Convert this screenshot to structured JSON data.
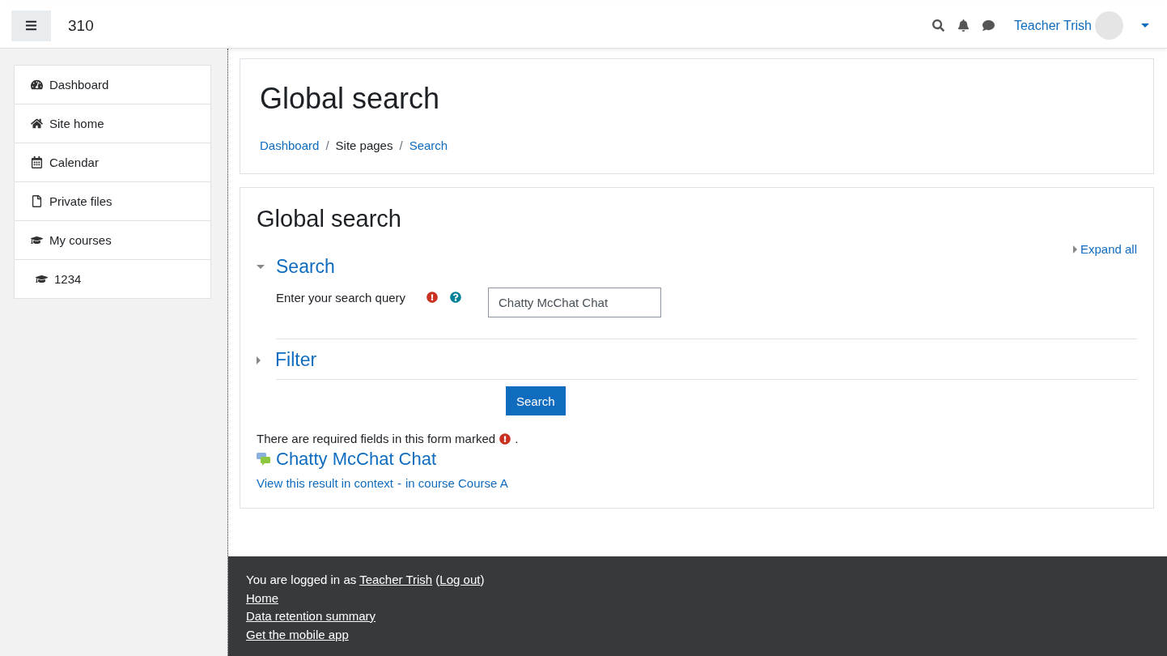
{
  "navbar": {
    "site_name": "310",
    "user_name": "Teacher Trish",
    "user_menu_expanded": false
  },
  "nav": {
    "items": [
      {
        "label": "Dashboard"
      },
      {
        "label": "Site home"
      },
      {
        "label": "Calendar"
      },
      {
        "label": "Private files"
      },
      {
        "label": "My courses",
        "children": [
          {
            "label": "1234"
          }
        ]
      }
    ]
  },
  "header": {
    "title": "Global search",
    "breadcrumbs": [
      {
        "label": "Dashboard",
        "link": true
      },
      {
        "label": "Site pages",
        "link": false
      },
      {
        "label": "Search",
        "link": true
      }
    ],
    "separator": "/"
  },
  "form": {
    "title": "Global search",
    "expand_all": "Expand all",
    "sections": [
      {
        "title": "Search",
        "expanded": true,
        "fields": [
          {
            "label": "Enter your search query",
            "required": true,
            "help": true,
            "value": "Chatty McChat Chat"
          }
        ]
      },
      {
        "title": "Filter",
        "expanded": false
      }
    ],
    "submit": "Search",
    "required_note": "There are required fields in this form marked",
    "required_note_end": "."
  },
  "result": {
    "title": "Chatty McChat Chat",
    "context_link": "View this result in context",
    "separator": "-",
    "course_link": "in course Course A"
  },
  "footer": {
    "login_prefix": "You are logged in as",
    "user": "Teacher Trish",
    "paren_open": "(",
    "logout": "Log out",
    "paren_close": ")",
    "links": [
      "Home",
      "Data retention summary",
      "Get the mobile app"
    ]
  }
}
